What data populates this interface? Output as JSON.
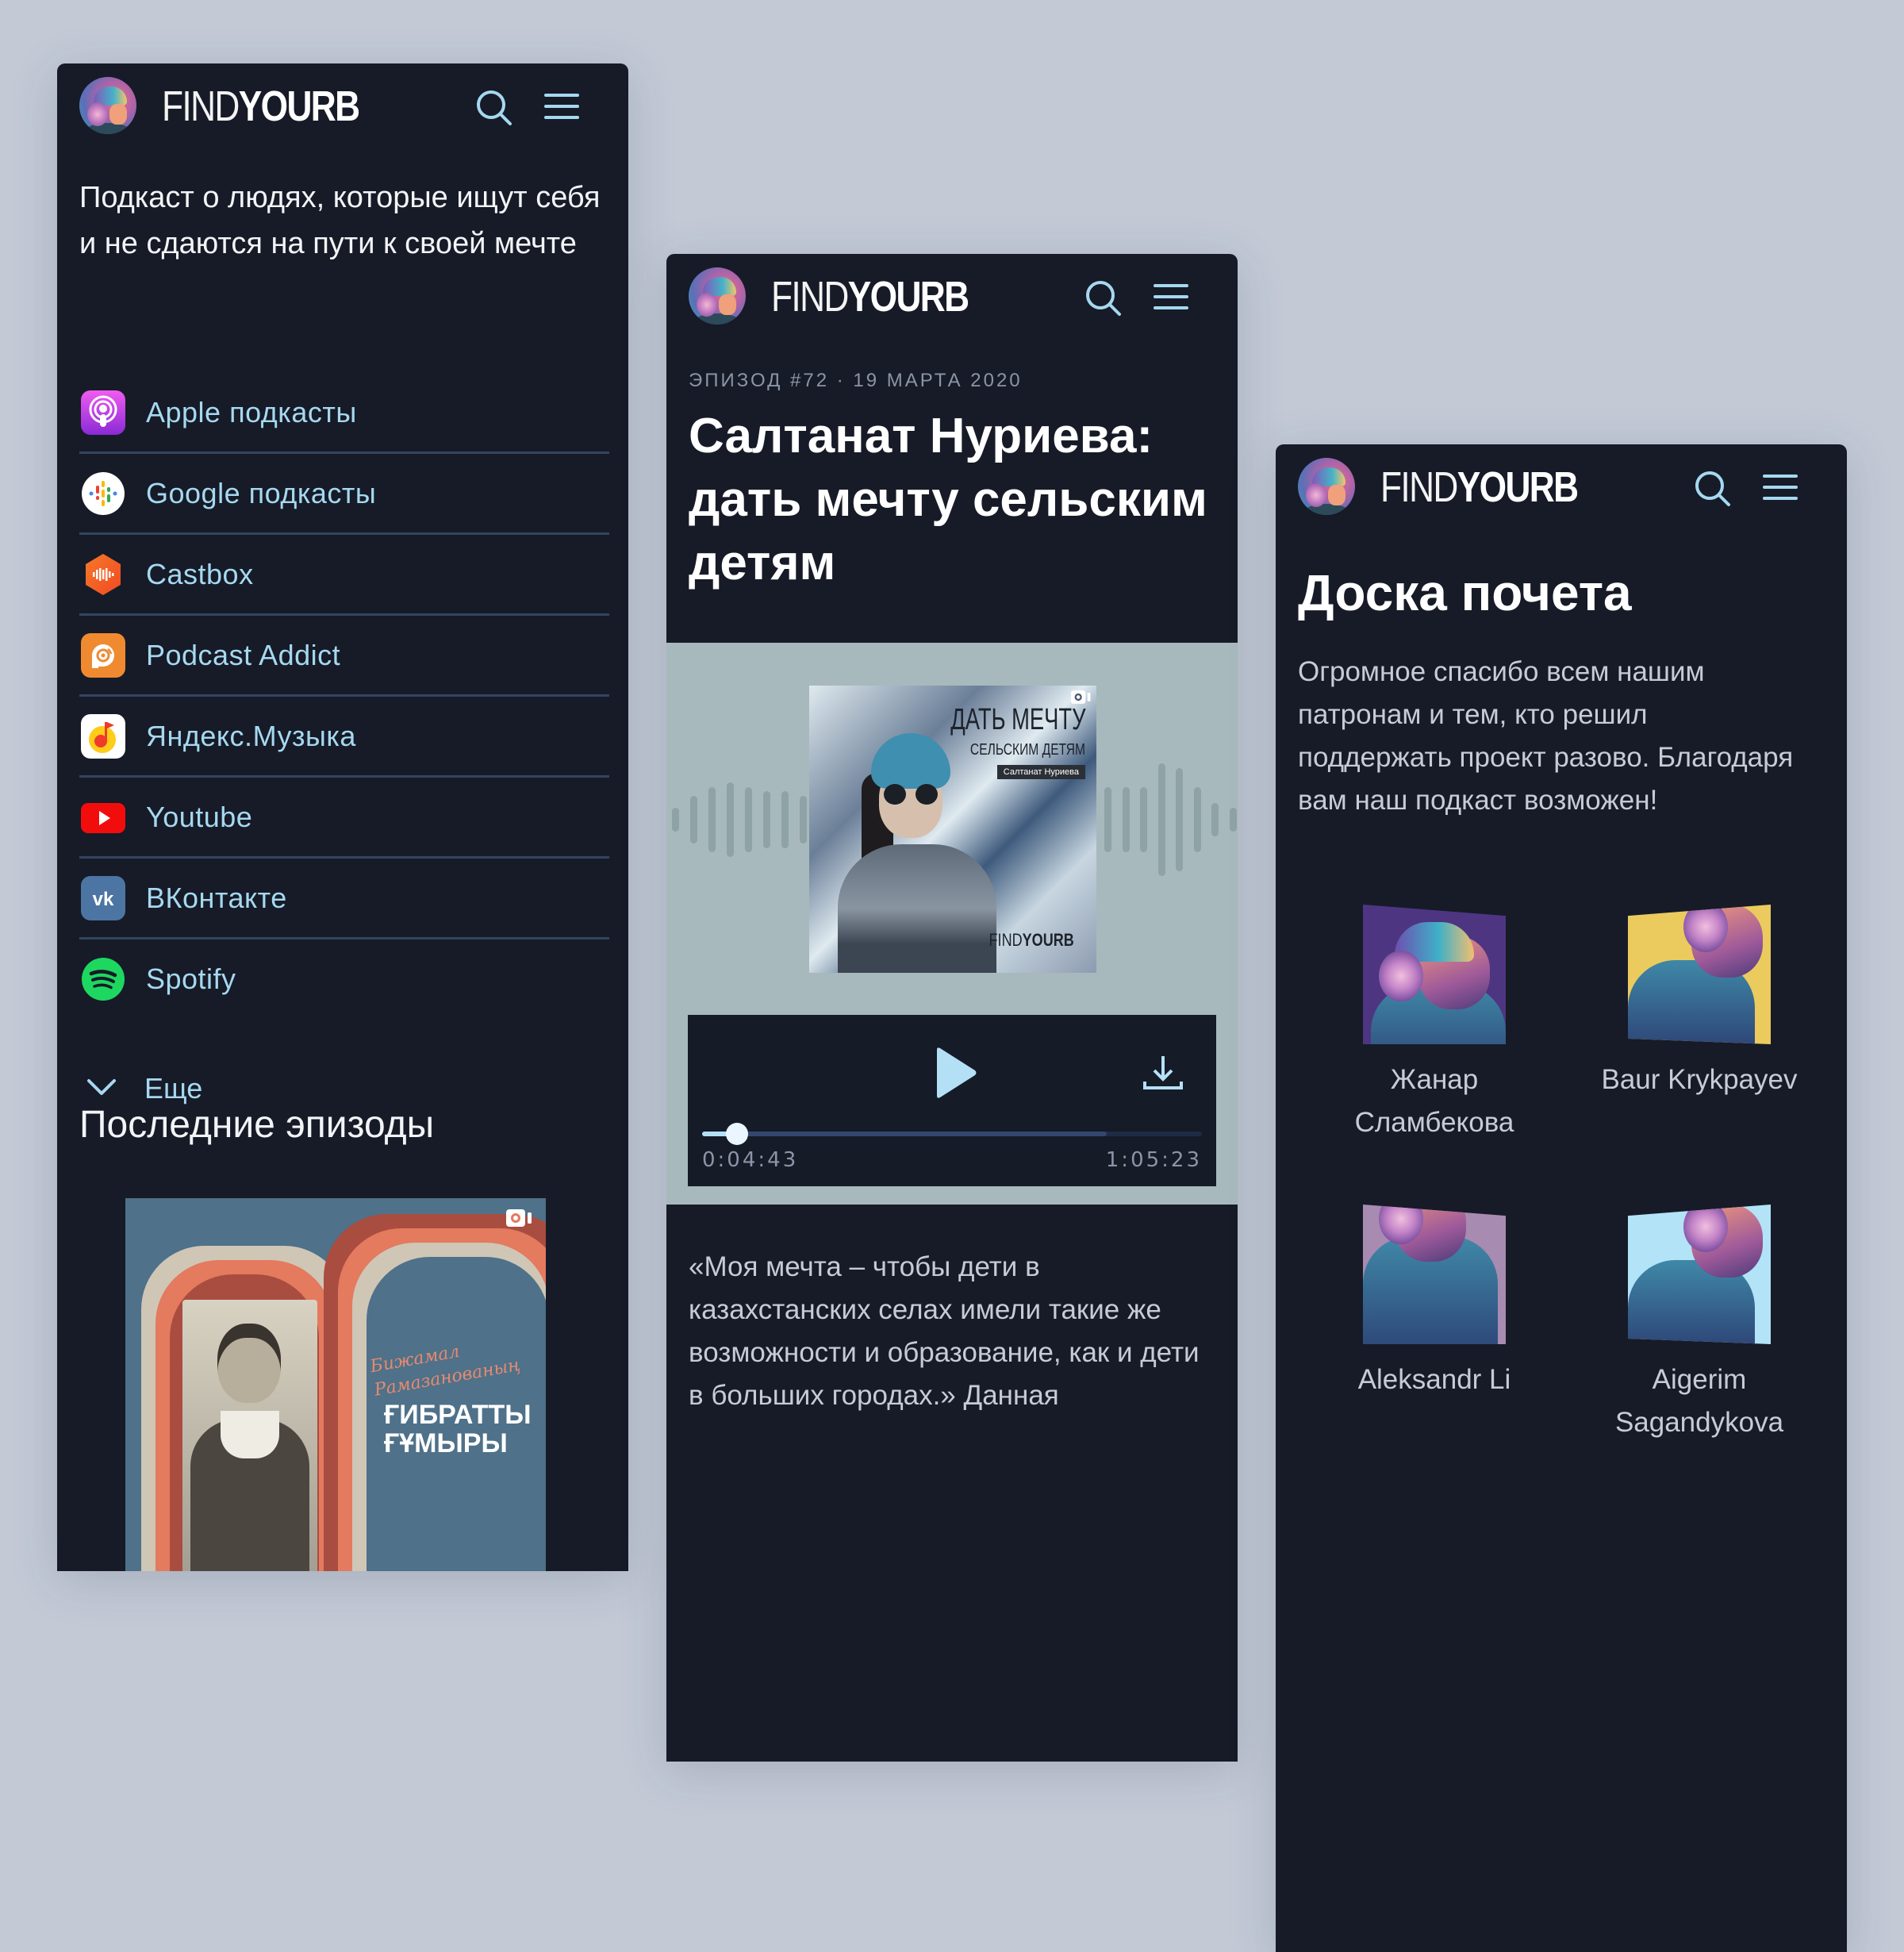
{
  "brand": {
    "wordmark_thin": "FIND",
    "wordmark_bold": "YOURB"
  },
  "colors": {
    "page_background": "#c3cad6",
    "panel_background": "#161b27",
    "link": "#a6d8f0",
    "divider": "#344462",
    "muted_text": "#8c95a6",
    "body_text": "#c6cbd6",
    "player_zone": "#a7b9bc",
    "progress_fill": "#b4e0f6"
  },
  "home_page": {
    "tagline": "Подкаст о людях, которые ищут себя и не сдаются на пути к своей мечте",
    "platforms": [
      {
        "label": "Apple подкасты",
        "icon": "apple-podcasts-icon"
      },
      {
        "label": "Google подкасты",
        "icon": "google-podcasts-icon"
      },
      {
        "label": "Castbox",
        "icon": "castbox-icon"
      },
      {
        "label": "Podcast Addict",
        "icon": "podcast-addict-icon"
      },
      {
        "label": "Яндекс.Музыка",
        "icon": "yandex-music-icon"
      },
      {
        "label": "Youtube",
        "icon": "youtube-icon"
      },
      {
        "label": "ВКонтакте",
        "icon": "vk-icon"
      },
      {
        "label": "Spotify",
        "icon": "spotify-icon"
      }
    ],
    "more_label": "Еще",
    "latest_title": "Последние эпизоды",
    "latest_cover": {
      "script_line1": "Бижамал",
      "script_line2": "Рамазанованың",
      "title_line1": "ҒИБРАТТЫ",
      "title_line2": "ҒҰМЫРЫ"
    }
  },
  "episode_page": {
    "meta": "ЭПИЗОД #72 · 19 МАРТА 2020",
    "title": "Салтанат Нуриева: дать мечту сельским детям",
    "cover": {
      "title": "ДАТЬ МЕЧТУ",
      "subtitle": "СЕЛЬСКИМ ДЕТЯМ",
      "guest_tag": "Салтанат Нуриева",
      "brand_thin": "FIND",
      "brand_bold": "YOURB"
    },
    "player": {
      "current_time": "0:04:43",
      "total_time": "1:05:23",
      "progress_fraction": 0.07,
      "buffered_fraction": 0.81
    },
    "quote": "«Моя мечта – чтобы дети в казахстанских селах имели такие же возможности и образование, как и дети в больших городах.» Данная"
  },
  "honor_page": {
    "title": "Доска почета",
    "text": "Огромное спасибо всем нашим патронам и тем, кто решил поддержать проект разово. Благодаря вам наш подкаст возможен!",
    "patrons": [
      {
        "name": "Жанар Сламбекова",
        "bg": "#4e3582"
      },
      {
        "name": "Baur Krykpayev",
        "bg": "#ebcb5e"
      },
      {
        "name": "Aleksandr Li",
        "bg": "#a88bb0"
      },
      {
        "name": "Aigerim Sagandykova",
        "bg": "#b3e3f7"
      }
    ]
  }
}
